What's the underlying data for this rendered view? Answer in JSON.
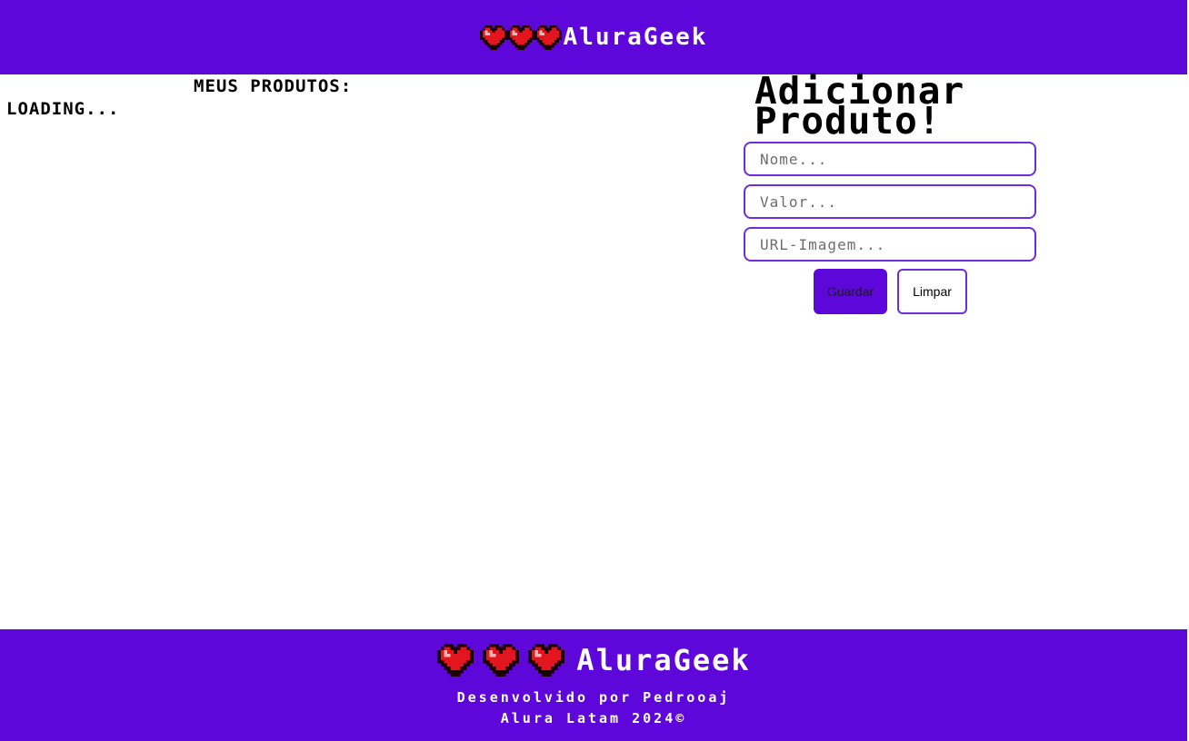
{
  "header": {
    "brand_name": "AluraGeek",
    "hearts": [
      "heart-icon",
      "heart-icon",
      "heart-icon"
    ]
  },
  "products": {
    "title": "MEUS PRODUTOS:",
    "status": "LOADING..."
  },
  "form": {
    "title_line1": "Adicionar",
    "title_line2": "Produto!",
    "fields": {
      "nome": {
        "placeholder": "Nome...",
        "value": ""
      },
      "valor": {
        "placeholder": "Valor...",
        "value": ""
      },
      "url": {
        "placeholder": "URL-Imagem...",
        "value": ""
      }
    },
    "buttons": {
      "save_label": "Guardar",
      "clear_label": "Limpar"
    }
  },
  "footer": {
    "brand_name": "AluraGeek",
    "credit_line1": "Desenvolvido por Pedrooaj",
    "credit_line2": "Alura Latam 2024©"
  },
  "colors": {
    "brand_purple": "#5d07db",
    "input_border": "#6c2de0",
    "heart_red": "#e3151f"
  }
}
